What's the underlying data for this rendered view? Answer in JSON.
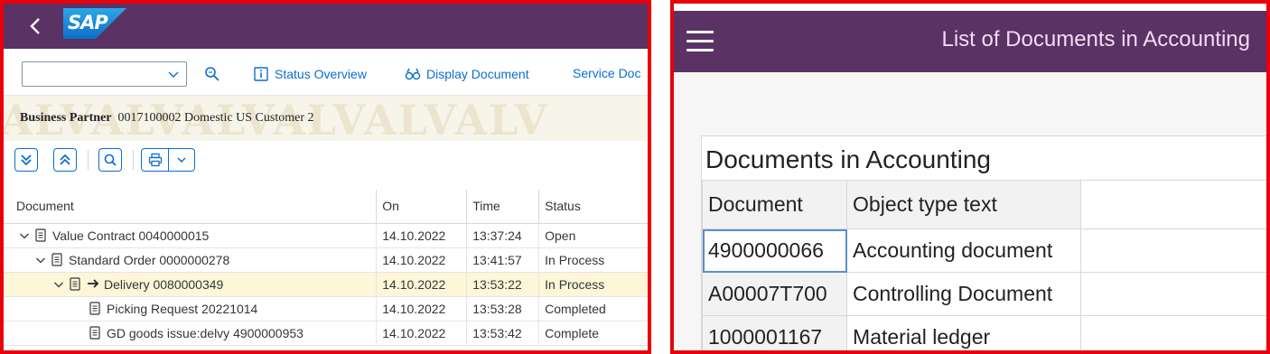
{
  "left": {
    "logo_text": "SAP",
    "toolbar": {
      "variant_value": "",
      "status_overview": "Status Overview",
      "display_document": "Display Document",
      "service_doc": "Service Doc"
    },
    "watermark": "ALVALVALVALVALVALV",
    "business_partner": {
      "label": "Business Partner",
      "value": "0017100002 Domestic US Customer 2"
    },
    "table": {
      "headers": [
        "Document",
        "On",
        "Time",
        "Status"
      ],
      "rows": [
        {
          "doc": "Value Contract 0040000015",
          "on": "14.10.2022",
          "time": "13:37:24",
          "status": "Open"
        },
        {
          "doc": "Standard Order 0000000278",
          "on": "14.10.2022",
          "time": "13:41:57",
          "status": "In Process"
        },
        {
          "doc": "Delivery 0080000349",
          "on": "14.10.2022",
          "time": "13:53:22",
          "status": "In Process"
        },
        {
          "doc": "Picking Request 20221014",
          "on": "14.10.2022",
          "time": "13:53:28",
          "status": "Completed"
        },
        {
          "doc": "GD goods issue:delvy 4900000953",
          "on": "14.10.2022",
          "time": "13:53:42",
          "status": "Complete"
        }
      ]
    }
  },
  "right": {
    "title": "List of Documents in Accounting",
    "box_title": "Documents in Accounting",
    "table": {
      "headers": [
        "Document",
        "Object type text"
      ],
      "rows": [
        {
          "doc": "4900000066",
          "type": "Accounting document"
        },
        {
          "doc": "A00007T700",
          "type": "Controlling Document"
        },
        {
          "doc": "1000001167",
          "type": "Material ledger"
        }
      ]
    }
  },
  "colors": {
    "header_purple": "#5a3264",
    "link_blue": "#0a6ed1",
    "highlight_border": "#e8000b",
    "selected_row": "#fdf6d8"
  }
}
